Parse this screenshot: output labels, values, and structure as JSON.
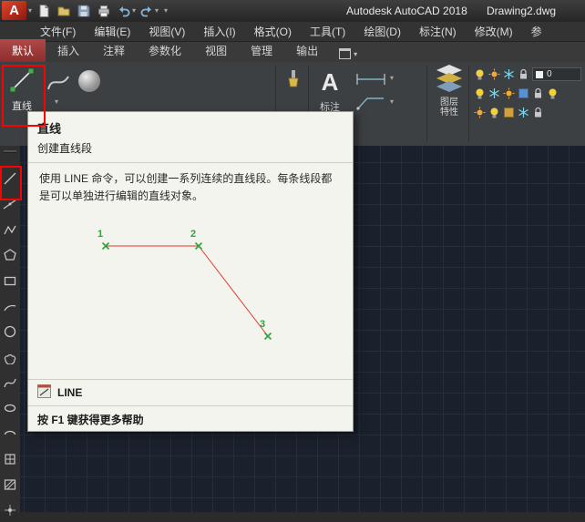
{
  "icons": {
    "caret": "▾"
  },
  "titlebar": {
    "logo_letter": "A",
    "app_title": "Autodesk AutoCAD 2018",
    "doc_title": "Drawing2.dwg",
    "quick_access": [
      "new-file",
      "open-file",
      "save",
      "plot",
      "undo",
      "redo"
    ]
  },
  "menubar": {
    "items": [
      {
        "label": "文件(F)"
      },
      {
        "label": "编辑(E)"
      },
      {
        "label": "视图(V)"
      },
      {
        "label": "插入(I)"
      },
      {
        "label": "格式(O)"
      },
      {
        "label": "工具(T)"
      },
      {
        "label": "绘图(D)"
      },
      {
        "label": "标注(N)"
      },
      {
        "label": "修改(M)"
      },
      {
        "label": "参"
      }
    ]
  },
  "ribbon": {
    "tabs": [
      {
        "label": "默认",
        "active": true
      },
      {
        "label": "插入",
        "active": false
      },
      {
        "label": "注释",
        "active": false
      },
      {
        "label": "参数化",
        "active": false
      },
      {
        "label": "视图",
        "active": false
      },
      {
        "label": "管理",
        "active": false
      },
      {
        "label": "输出",
        "active": false
      }
    ],
    "draw_panel": {
      "line_label": "直线"
    },
    "annotate_panel": {
      "big_letter": "A",
      "label": "标注"
    },
    "layers_panel": {
      "label_line1": "图层",
      "label_line2": "特性",
      "current_layer": "0"
    }
  },
  "left_toolbar": {
    "tools": [
      "line",
      "construction-line",
      "polyline",
      "polygon",
      "rectangle",
      "arc",
      "circle",
      "revision-cloud",
      "spline",
      "ellipse",
      "ellipse-arc",
      "insert-block",
      "hatch",
      "point"
    ]
  },
  "tooltip": {
    "title": "直线",
    "subtitle": "创建直线段",
    "body": "使用 LINE 命令，可以创建一系列连续的直线段。每条线段都是可以单独进行编辑的直线对象。",
    "command_name": "LINE",
    "footer": "按 F1 键获得更多帮助",
    "diagram": {
      "point1": "1",
      "point2": "2",
      "point3": "3"
    }
  },
  "colors": {
    "logo_red": "#c8311e",
    "highlight_box_red": "#ff0000",
    "active_tab_red": "#9e3639",
    "tooltip_bg": "#f4f4ee",
    "canvas_bg": "#1b212c",
    "grid_line": "#262e3a",
    "diagram_line_red": "#e0392e",
    "diagram_marker_green": "#2fa33c"
  }
}
